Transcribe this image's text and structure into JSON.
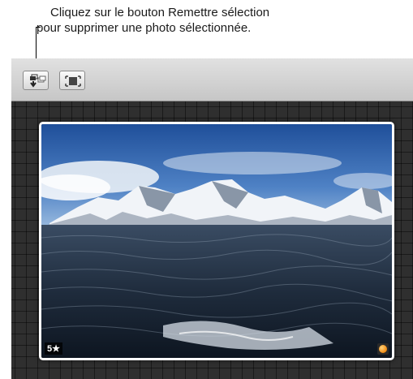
{
  "callout": {
    "line1": "Cliquez sur le bouton Remettre sélection",
    "line2": "pour supprimer une photo sélectionnée."
  },
  "toolbar": {
    "buttons": [
      {
        "icon": "put-back-selection-icon"
      },
      {
        "icon": "fit-to-frame-icon"
      }
    ]
  },
  "photo": {
    "rating": "5★",
    "adjustment_icon": "orange-adjustment-badge-icon"
  },
  "colors": {
    "canvas_bg": "#2f2f2f",
    "toolbar_bg": "#d4d4d4",
    "badge_orange": "#f08a12"
  }
}
